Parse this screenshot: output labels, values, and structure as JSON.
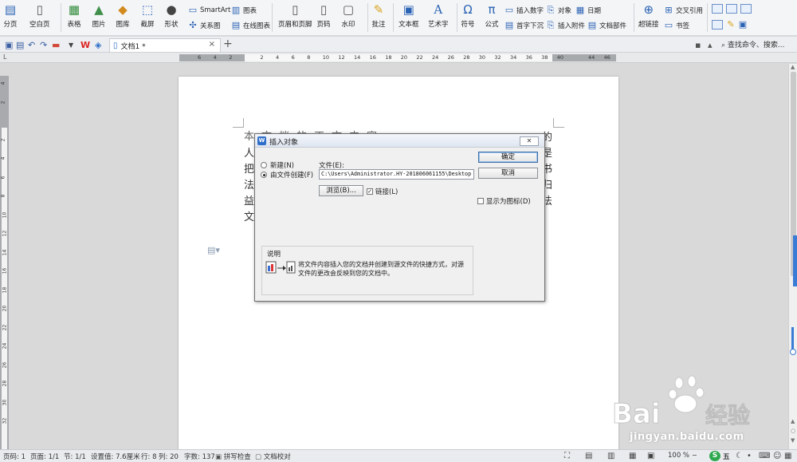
{
  "ribbon": {
    "groups": [
      {
        "label": "分页",
        "icon": "page-break-icon"
      },
      {
        "label": "空白页",
        "icon": "blank-page-icon"
      },
      {
        "label": "表格",
        "icon": "table-icon"
      },
      {
        "label": "图片",
        "icon": "picture-icon"
      },
      {
        "label": "图库",
        "icon": "gallery-icon"
      },
      {
        "label": "截屏",
        "icon": "screenshot-icon"
      },
      {
        "label": "形状",
        "icon": "shape-icon"
      },
      {
        "label": "页眉和页脚",
        "icon": "header-footer-icon"
      },
      {
        "label": "页码",
        "icon": "page-number-icon"
      },
      {
        "label": "水印",
        "icon": "watermark-icon"
      },
      {
        "label": "批注",
        "icon": "comment-icon"
      },
      {
        "label": "文本框",
        "icon": "textbox-icon"
      },
      {
        "label": "艺术字",
        "icon": "wordart-icon"
      },
      {
        "label": "符号",
        "icon": "symbol-icon"
      },
      {
        "label": "公式",
        "icon": "formula-icon"
      },
      {
        "label": "超链接",
        "icon": "hyperlink-icon"
      }
    ],
    "small": {
      "smartart": "SmartArt",
      "chart": "图表",
      "relation": "关系图",
      "online_chart": "在线图表",
      "insert_number": "插入数字",
      "object": "对象",
      "date": "日期",
      "drop_cap": "首字下沉",
      "insert_attachment": "插入附件",
      "doc_parts": "文档部件",
      "cross_ref": "交叉引用",
      "bookmark": "书签"
    }
  },
  "tabbar": {
    "doc_tab": "文档1 *",
    "search": "查找命令、搜索..."
  },
  "ruler": {
    "ticks": [
      "6",
      "4",
      "2",
      "",
      "2",
      "4",
      "6",
      "8",
      "10",
      "12",
      "14",
      "16",
      "18",
      "20",
      "22",
      "24",
      "26",
      "28",
      "30",
      "32",
      "34",
      "36",
      "38",
      "40",
      "",
      "44",
      "46"
    ]
  },
  "vruler": {
    "ticks": [
      "4",
      "2",
      "",
      "2",
      "4",
      "6",
      "8",
      "10",
      "12",
      "14",
      "16",
      "18",
      "20",
      "22",
      "24",
      "26",
      "28",
      "30",
      "32"
    ]
  },
  "document": {
    "chars_right": [
      "的",
      "是",
      "书",
      "归",
      "法"
    ],
    "chars_left": [
      "人",
      "把",
      "法",
      "益",
      "文"
    ],
    "top_row": "本文档的正文内容"
  },
  "dialog": {
    "title": "插入对象",
    "close": "✕",
    "radio_new": "新建(N)",
    "radio_from_file": "由文件创建(F)",
    "file_label": "文件(E):",
    "file_path": "C:\\Users\\Administrator.HY-201806061155\\Desktop",
    "browse": "浏览(B)...",
    "link": "链接(L)",
    "ok": "确定",
    "cancel": "取消",
    "display_as_icon": "显示为图标(D)",
    "desc_title": "说明",
    "desc_text": "将文件内容插入您的文档并创建到源文件的快捷方式，对源文件的更改会反映到您的文档中。"
  },
  "statusbar": {
    "page_num": "页码: 1",
    "pages": "页面: 1/1",
    "section": "节: 1/1",
    "setting": "设置值: 7.6厘米",
    "row": "行: 8",
    "col": "列: 20",
    "words": "字数: 137",
    "spell": "拼写检查",
    "proof": "文档校对",
    "zoom": "100 %",
    "ime": "五"
  },
  "watermark": {
    "text": "jingyan.baidu.com"
  }
}
